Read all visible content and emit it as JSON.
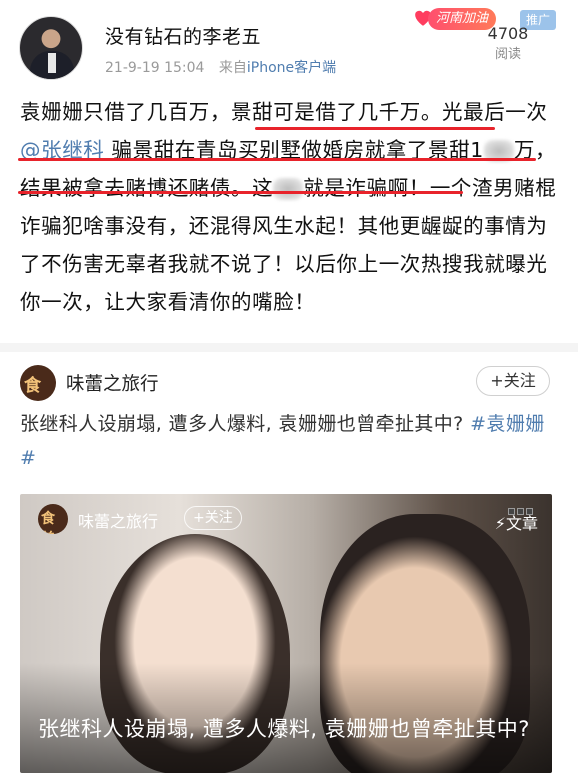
{
  "post": {
    "user_name": "没有钻石的李老五",
    "timestamp": "21-9-19 15:04",
    "source_prefix": "来自",
    "source": "iPhone客户端",
    "read_count": "4708",
    "read_label": "阅读",
    "badge_text": "河南加油",
    "promo_label": "推广",
    "body": {
      "seg1": "袁姗姗只借了几百万，",
      "seg2": "景甜可是借了几千万。",
      "seg3": "光最后一次",
      "mention": "@张继科",
      "seg4": " 骗景甜在青岛买别墅做婚房就拿了景甜1",
      "seg5": "万，",
      "seg6": "结果被拿去赌博还赌债。",
      "seg7": "这",
      "seg8": "就是诈骗啊！一个渣男赌棍诈骗犯啥事没有，还混得风生水起！其他更龌龊的事情为了不伤害无辜者我就不说了！以后你上一次热搜我就曝光你一次，让大家看清你的嘴脸！"
    }
  },
  "repost": {
    "user_name": "味蕾之旅行",
    "follow_label": "+关注",
    "text": "张继科人设崩塌, 遭多人爆料, 袁姗姗也曾牵扯其中? ",
    "hashtag": "#袁姗姗#"
  },
  "article_card": {
    "author": "味蕾之旅行",
    "follow_label": "+关注",
    "type_label": "文章",
    "title": "张继科人设崩塌, 遭多人爆料, 袁姗姗也曾牵扯其中?"
  },
  "colors": {
    "link": "#507daf",
    "highlight_underline": "#e8232b"
  },
  "icons": {
    "avatar_logo_text": "食美"
  }
}
